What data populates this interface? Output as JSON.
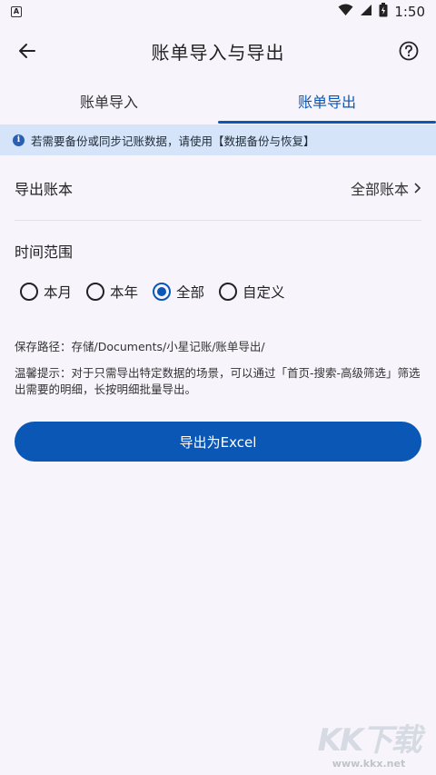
{
  "status_bar": {
    "sim_label": "A",
    "time": "1:50",
    "icons": [
      "sim-card-icon",
      "wifi-icon",
      "signal-icon",
      "battery-icon"
    ]
  },
  "app_bar": {
    "title": "账单导入与导出",
    "back_icon": "arrow-back-icon",
    "help_icon": "help-circle-icon"
  },
  "tabs": [
    {
      "label": "账单导入",
      "active": false
    },
    {
      "label": "账单导出",
      "active": true
    }
  ],
  "notice": {
    "text": "若需要备份或同步记账数据，请使用【数据备份与恢复】"
  },
  "export_book": {
    "label": "导出账本",
    "value": "全部账本"
  },
  "time_range": {
    "title": "时间范围",
    "options": [
      {
        "label": "本月",
        "checked": false
      },
      {
        "label": "本年",
        "checked": false
      },
      {
        "label": "全部",
        "checked": true
      },
      {
        "label": "自定义",
        "checked": false
      }
    ]
  },
  "save_path": "保存路径：存储/Documents/小星记账/账单导出/",
  "tip": "温馨提示：对于只需导出特定数据的场景，可以通过「首页-搜索-高级筛选」筛选出需要的明细，长按明细批量导出。",
  "export_button": "导出为Excel",
  "watermark": {
    "logo": "KK下载",
    "url": "www.kkx.net"
  },
  "colors": {
    "accent": "#0b57b6",
    "notice_bg": "#d5e4f8",
    "background": "#f7f5fb"
  }
}
